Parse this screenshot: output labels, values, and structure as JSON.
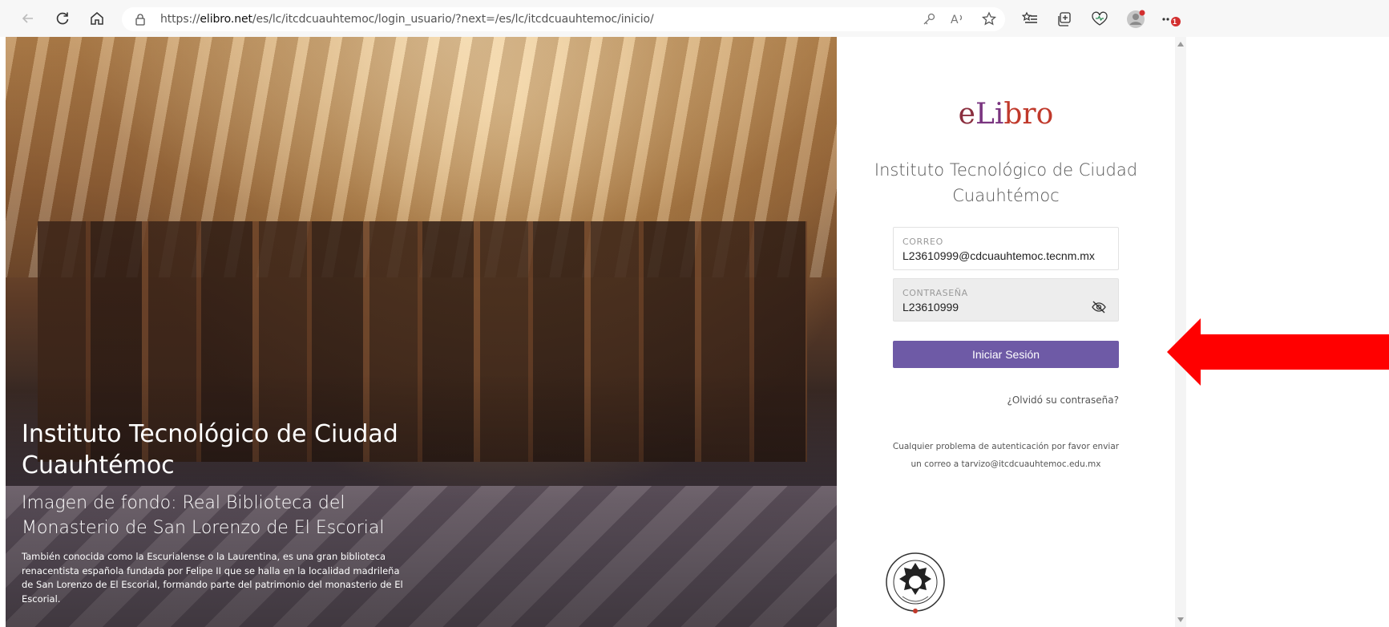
{
  "browser": {
    "url_prefix": "https://",
    "url_domain": "elibro.net",
    "url_path": "/es/lc/itcdcuauhtemoc/login_usuario/?next=/es/lc/itcdcuauhtemoc/inicio/",
    "notification_badge": "1",
    "icons": [
      "back-arrow-icon",
      "refresh-icon",
      "home-icon",
      "lock-icon",
      "key-icon",
      "read-aloud-icon",
      "favorite-add-icon",
      "favorites-icon",
      "collections-icon",
      "health-icon",
      "profile-icon",
      "more-icon"
    ]
  },
  "hero": {
    "title": "Instituto Tecnológico de Ciudad Cuauhtémoc",
    "subtitle": "Imagen de fondo: Real Biblioteca del Monasterio de San Lorenzo de El Escorial",
    "description": "También conocida como la Escurialense o la Laurentina, es una gran biblioteca renacentista española fundada por Felipe II que se halla en la localidad madrileña de San Lorenzo de El Escorial, formando parte del patrimonio del monasterio de El Escorial."
  },
  "login": {
    "logo_e": "e",
    "logo_li": "Li",
    "logo_bro": "bro",
    "institution": "Instituto Tecnológico de Ciudad Cuauhtémoc",
    "email_label": "CORREO",
    "email_value": "L23610999@cdcuauhtemoc.tecnm.mx",
    "password_label": "CONTRASEÑA",
    "password_value": "L23610999",
    "submit_label": "Iniciar Sesión",
    "forgot_label": "¿Olvidó su contraseña?",
    "notice_line1": "Cualquier problema de autenticación por favor enviar",
    "notice_line2": "un correo a tarvizo@itcdcuauhtemoc.edu.mx"
  },
  "colors": {
    "button": "#6e5aa6",
    "annotation_arrow": "#ff0000",
    "badge": "#d32f2f"
  }
}
